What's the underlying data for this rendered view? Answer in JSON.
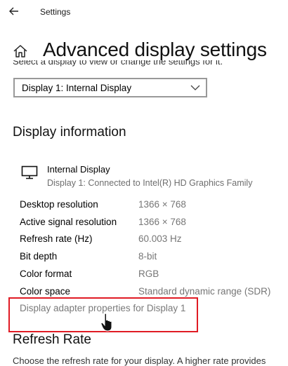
{
  "window": {
    "title": "Settings"
  },
  "header": {
    "title": "Advanced display settings"
  },
  "display_select": {
    "hint": "Select a display to view or change the settings for it.",
    "selected": "Display 1: Internal Display"
  },
  "display_information": {
    "heading": "Display information",
    "monitor_name": "Internal Display",
    "monitor_subtitle": "Display 1: Connected to Intel(R) HD Graphics Family",
    "properties": [
      {
        "label": "Desktop resolution",
        "value": "1366 × 768"
      },
      {
        "label": "Active signal resolution",
        "value": "1366 × 768"
      },
      {
        "label": "Refresh rate (Hz)",
        "value": "60.003 Hz"
      },
      {
        "label": "Bit depth",
        "value": "8-bit"
      },
      {
        "label": "Color format",
        "value": "RGB"
      },
      {
        "label": "Color space",
        "value": "Standard dynamic range (SDR)"
      }
    ],
    "adapter_link": "Display adapter properties for Display 1"
  },
  "refresh_rate": {
    "heading": "Refresh Rate",
    "description": "Choose the refresh rate for your display. A higher rate provides"
  },
  "colors": {
    "highlight": "#e01b24",
    "secondary_text": "#767676"
  },
  "icons": [
    "back-arrow-icon",
    "home-icon",
    "chevron-down-icon",
    "monitor-icon",
    "hand-cursor-icon"
  ]
}
